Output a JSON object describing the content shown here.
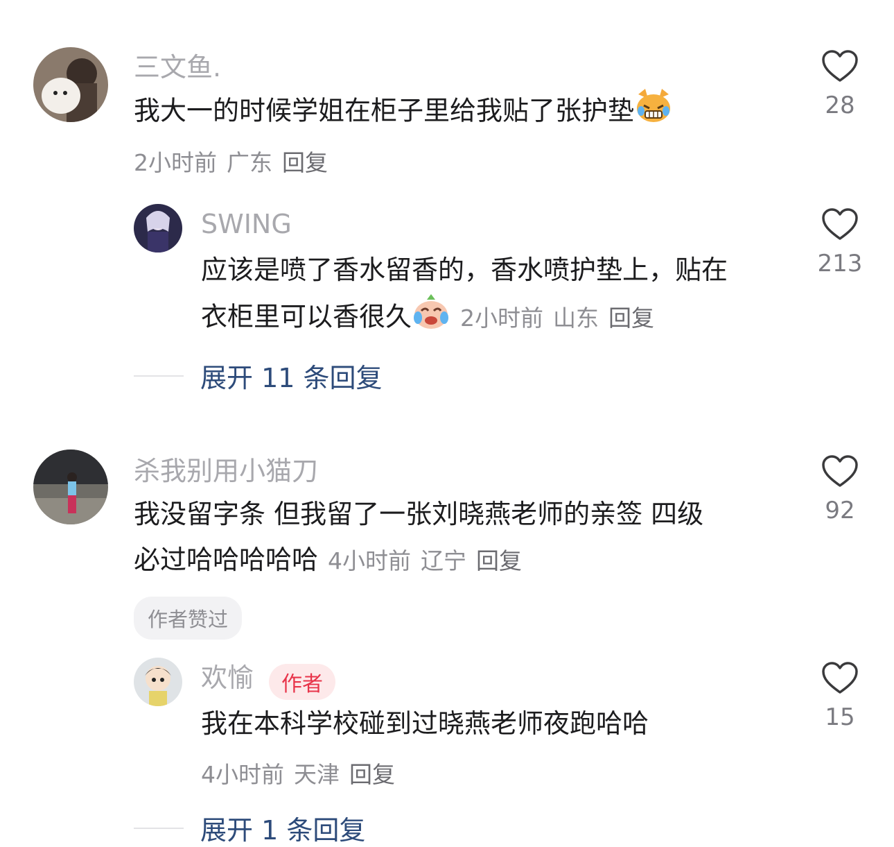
{
  "comments": [
    {
      "username": "三文鱼.",
      "text": "我大一的时候学姐在柜子里给我贴了张护垫",
      "emoji": "cat-grimace-emoji",
      "time": "2小时前",
      "location": "广东",
      "reply_label": "回复",
      "likes": "28",
      "replies": [
        {
          "username": "SWING",
          "text_line1": "应该是喷了香水留香的，香水喷护垫上，贴在",
          "text_line2": "衣柜里可以香很久",
          "emoji": "crying-laugh-emoji",
          "time": "2小时前",
          "location": "山东",
          "reply_label": "回复",
          "likes": "213"
        }
      ],
      "expand_label": "展开 11 条回复"
    },
    {
      "username": "杀我别用小猫刀",
      "text_line1": "我没留字条 但我留了一张刘晓燕老师的亲签 四级",
      "text_line2": "必过哈哈哈哈哈",
      "time": "4小时前",
      "location": "辽宁",
      "reply_label": "回复",
      "likes": "92",
      "author_liked": "作者赞过",
      "replies": [
        {
          "username": "欢愉",
          "author_tag": "作者",
          "text": "我在本科学校碰到过晓燕老师夜跑哈哈",
          "time": "4小时前",
          "location": "天津",
          "reply_label": "回复",
          "likes": "15"
        }
      ],
      "expand_label": "展开 1 条回复"
    }
  ],
  "colors": {
    "username": "#a8a8ad",
    "text": "#1c1c1e",
    "meta": "#8e8e93",
    "expand": "#2d4b7a",
    "author_tag_bg": "#fde9ea",
    "author_tag_fg": "#e8344a"
  }
}
